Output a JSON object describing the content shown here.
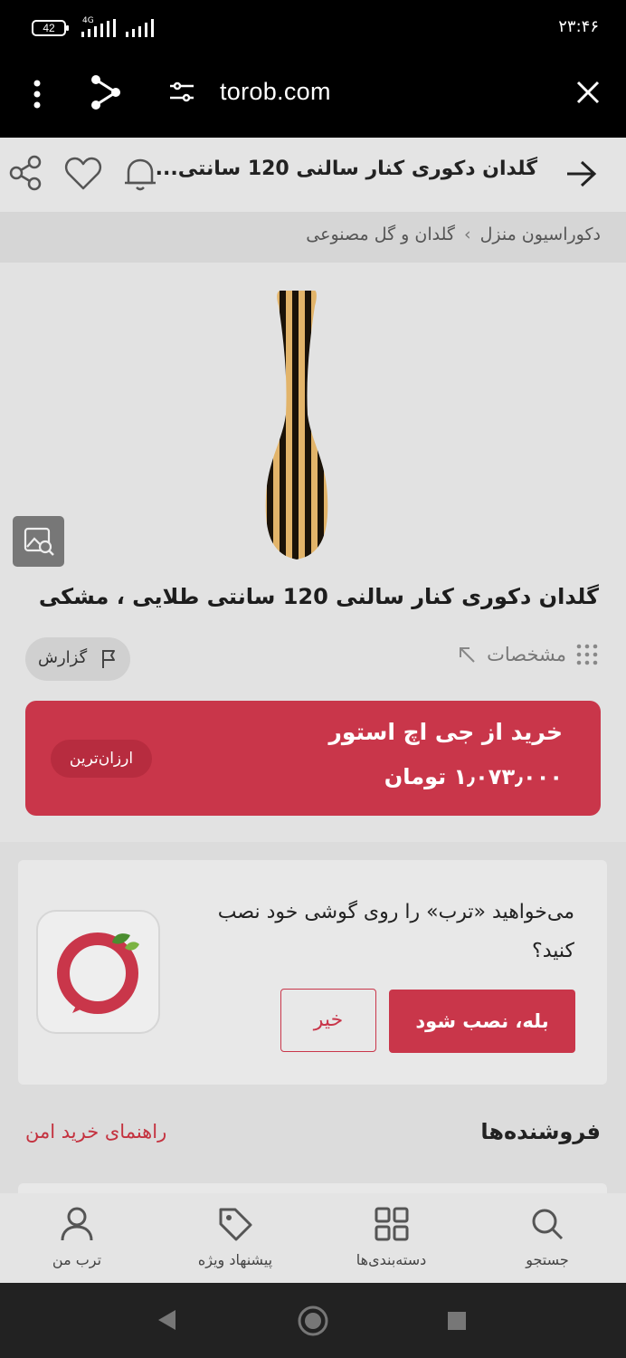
{
  "status_bar": {
    "battery": "42",
    "network": "4G",
    "time": "۲۳:۴۶"
  },
  "browser": {
    "url": "torob.com",
    "icons": [
      "more-vert-icon",
      "share-nodes-icon",
      "site-settings-icon",
      "close-icon"
    ]
  },
  "header": {
    "title": "گلدان دکوری کنار سالنی 120 سانتی...",
    "icons": [
      "back-arrow-icon",
      "bell-icon",
      "heart-icon",
      "share-icon"
    ]
  },
  "breadcrumb": {
    "items": [
      "دکوراسیون منزل",
      "گلدان و گل مصنوعی"
    ],
    "separator": "›"
  },
  "product": {
    "title": "گلدان دکوری کنار سالنی 120 سانتی طلایی ، مشکی",
    "specs_label": "مشخصات",
    "report_label": "گزارش"
  },
  "buy_box": {
    "shop_label": "خرید از جی اچ استور",
    "price": "۱٫۰۷۳٫۰۰۰ تومان",
    "badge": "ارزان‌ترین",
    "color": "#c9364a"
  },
  "install_prompt": {
    "question": "می‌خواهید «ترب» را روی گوشی خود نصب کنید؟",
    "yes_label": "بله، نصب شود",
    "no_label": "خیر"
  },
  "sellers": {
    "title": "فروشنده‌ها",
    "guide_link": "راهنمای خرید امن"
  },
  "bottom_nav": [
    {
      "label": "جستجو",
      "icon": "search-icon"
    },
    {
      "label": "دسته‌بندی‌ها",
      "icon": "grid-icon"
    },
    {
      "label": "پیشنهاد ویژه",
      "icon": "tag-icon"
    },
    {
      "label": "ترب من",
      "icon": "user-icon"
    }
  ]
}
